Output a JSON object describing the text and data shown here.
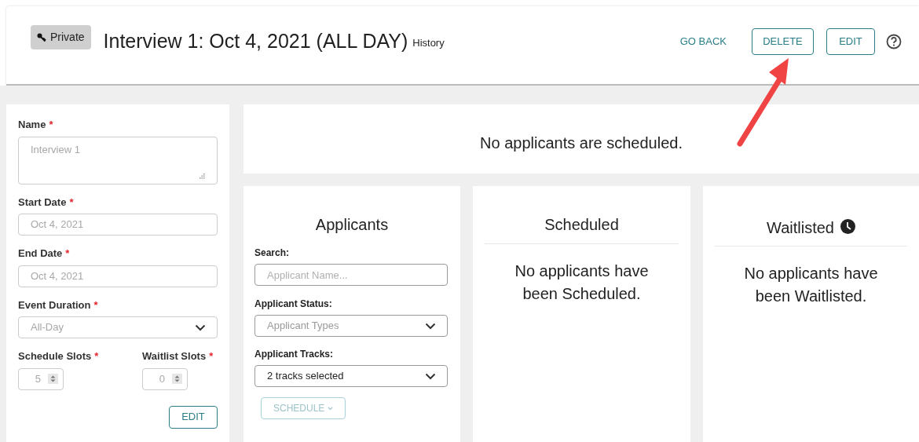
{
  "header": {
    "badge": "Private",
    "title": "Interview 1: Oct 4, 2021 (ALL DAY)",
    "history_link": "History",
    "actions": [
      {
        "label": "GO BACK",
        "kind": "link"
      },
      {
        "label": "DELETE",
        "kind": "outline"
      },
      {
        "label": "EDIT",
        "kind": "outline"
      }
    ]
  },
  "form": {
    "fields": [
      {
        "label": "Name",
        "required_mark": "*",
        "kind": "textarea",
        "value": "Interview 1",
        "disabled": true
      },
      {
        "label": "Start Date",
        "required_mark": "*",
        "kind": "text",
        "value": "Oct 4, 2021",
        "disabled": true
      },
      {
        "label": "End Date",
        "required_mark": "*",
        "kind": "text",
        "value": "Oct 4, 2021",
        "disabled": true
      },
      {
        "label": "Event Duration",
        "required_mark": "*",
        "kind": "select",
        "value": "All-Day",
        "disabled": true
      }
    ],
    "slots": [
      {
        "label": "Schedule Slots",
        "required_mark": "*",
        "value": "5",
        "disabled": true
      },
      {
        "label": "Waitlist Slots",
        "required_mark": "*",
        "value": "0",
        "disabled": true
      }
    ],
    "edit_button": "EDIT"
  },
  "banner": "No applicants are scheduled.",
  "applicants": {
    "title": "Applicants",
    "search": {
      "label": "Search:",
      "placeholder": "Applicant Name..."
    },
    "filters": [
      {
        "label": "Applicant Status:",
        "placeholder": "Applicant Types"
      },
      {
        "label": "Applicant Tracks:",
        "value": "2 tracks selected"
      }
    ],
    "schedule_button": {
      "label": "SCHEDULE",
      "disabled": true
    }
  },
  "lists": [
    {
      "title": "Scheduled",
      "clock": false,
      "empty_text": "No applicants have been Scheduled."
    },
    {
      "title": "Waitlisted",
      "clock": true,
      "empty_text": "No applicants have been Waitlisted."
    }
  ]
}
